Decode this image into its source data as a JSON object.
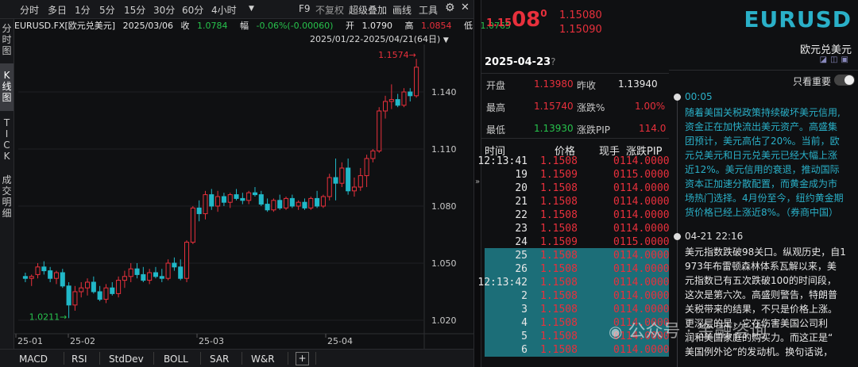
{
  "toolbar": {
    "periods": [
      "分时",
      "多日",
      "1分",
      "5分",
      "15分",
      "30分",
      "60分",
      "4小时"
    ],
    "f9": "F9",
    "nofq": "不复权",
    "overlay": "超级叠加",
    "draw": "画线",
    "tools": "工具"
  },
  "sidebar": {
    "tabs": [
      "分时图",
      "K线图",
      "TICK",
      "成交明细"
    ]
  },
  "info": {
    "symbol": "EURUSD.FX[欧元兑美元]",
    "date": "2025/03/06",
    "close_label": "收",
    "close": "1.0784",
    "change_label": "幅",
    "change": "-0.06%(-0.00060)",
    "open_label": "开",
    "open": "1.0790",
    "high_label": "高",
    "high": "1.0854",
    "low_label": "低",
    "low": "1.0765"
  },
  "range": "2025/01/22-2025/04/21(64日)",
  "annot": {
    "high": "1.1574",
    "low": "1.0211"
  },
  "axis": {
    "y_ticks": [
      "1.140",
      "1.110",
      "1.080",
      "1.050",
      "1.020"
    ],
    "x_ticks": [
      "25-01",
      "25-02",
      "25-03",
      "25-04"
    ]
  },
  "indicators": [
    "MACD",
    "RSI",
    "StdDev",
    "BOLL",
    "SAR",
    "W&R"
  ],
  "quote": {
    "price_small": "1.15",
    "price_big": "08",
    "price_sup": "0",
    "bid": "1.15080",
    "ask": "1.15090",
    "date": "2025-04-23",
    "open_l": "开盘",
    "open_v": "1.13980",
    "prev_l": "昨收",
    "prev_v": "1.13940",
    "high_l": "最高",
    "high_v": "1.15740",
    "chg_l": "涨跌%",
    "chg_v": "1.00%",
    "low_l": "最低",
    "low_v": "1.13930",
    "pip_l": "涨跌PIP",
    "pip_v": "114.0"
  },
  "ticks_header": {
    "time": "时间",
    "price": "价格",
    "vol": "现手",
    "pip": "涨跌PIP"
  },
  "ticks": [
    {
      "t": "12:13:41",
      "p": "1.1508",
      "v": "0",
      "pip": "114.0000"
    },
    {
      "t": "19",
      "p": "1.1509",
      "v": "0",
      "pip": "115.0000"
    },
    {
      "t": "20",
      "p": "1.1508",
      "v": "0",
      "pip": "114.0000"
    },
    {
      "t": "21",
      "p": "1.1508",
      "v": "0",
      "pip": "114.0000"
    },
    {
      "t": "22",
      "p": "1.1508",
      "v": "0",
      "pip": "114.0000"
    },
    {
      "t": "23",
      "p": "1.1508",
      "v": "0",
      "pip": "114.0000"
    },
    {
      "t": "24",
      "p": "1.1509",
      "v": "0",
      "pip": "115.0000"
    },
    {
      "t": "25",
      "p": "1.1508",
      "v": "0",
      "pip": "114.0000"
    },
    {
      "t": "26",
      "p": "1.1508",
      "v": "0",
      "pip": "114.0000"
    },
    {
      "t": "12:13:42",
      "p": "1.1508",
      "v": "0",
      "pip": "114.0000"
    },
    {
      "t": "2",
      "p": "1.1508",
      "v": "0",
      "pip": "114.0000"
    },
    {
      "t": "3",
      "p": "1.1508",
      "v": "0",
      "pip": "114.0000"
    },
    {
      "t": "4",
      "p": "1.1508",
      "v": "0",
      "pip": "114.0000"
    },
    {
      "t": "5",
      "p": "1.1508",
      "v": "0",
      "pip": "114.0000"
    },
    {
      "t": "6",
      "p": "1.1508",
      "v": "0",
      "pip": "114.0000"
    }
  ],
  "symbol_panel": {
    "code": "EURUSD",
    "name": "欧元兑美元",
    "toggle_label": "只看重要"
  },
  "news": [
    {
      "time": "00:05",
      "lines": [
        "随着美国关税政策持续破坏美元信用,",
        "资金正在加快流出美元资产。高盛集",
        "团预计，美元高估了20%。当前，欧",
        "元兑美元和日元兑美元已经大幅上涨",
        "近12%。美元信用的衰退，推动国际",
        "资本正加速分散配置，而黄金成为市",
        "场热门选择。4月份至今，纽约黄金期",
        "货价格已经上涨近8%。（券商中国）"
      ]
    },
    {
      "time": "04-21  22:16",
      "lines": [
        "美元指数跌破98关口。纵观历史，自1",
        "973年布雷顿森林体系瓦解以来，美",
        "元指数已有五次跌破100的时间段，",
        "这次是第六次。高盛则警告，特朗普",
        "关税带来的结果，不只是价格上涨。",
        "更深层的是，它在伤害美国公司利",
        "润和美国家庭的购买力。而这正是“",
        "美国例外论”的发动机。换句话说，"
      ]
    }
  ],
  "watermark": "公众号 · 金融咨询",
  "chart_data": {
    "type": "candlestick",
    "title": "EURUSD.FX[欧元兑美元]",
    "ylim": [
      1.015,
      1.165
    ],
    "candles": [
      [
        1.043,
        1.045,
        1.04,
        1.042
      ],
      [
        1.042,
        1.044,
        1.038,
        1.043
      ],
      [
        1.044,
        1.05,
        1.042,
        1.048
      ],
      [
        1.048,
        1.051,
        1.044,
        1.046
      ],
      [
        1.046,
        1.048,
        1.04,
        1.042
      ],
      [
        1.042,
        1.046,
        1.039,
        1.045
      ],
      [
        1.045,
        1.047,
        1.037,
        1.038
      ],
      [
        1.038,
        1.04,
        1.0211,
        1.028
      ],
      [
        1.028,
        1.038,
        1.025,
        1.035
      ],
      [
        1.035,
        1.04,
        1.032,
        1.037
      ],
      [
        1.037,
        1.042,
        1.033,
        1.04
      ],
      [
        1.04,
        1.043,
        1.034,
        1.035
      ],
      [
        1.035,
        1.038,
        1.03,
        1.031
      ],
      [
        1.031,
        1.039,
        1.029,
        1.037
      ],
      [
        1.037,
        1.04,
        1.033,
        1.034
      ],
      [
        1.034,
        1.043,
        1.032,
        1.041
      ],
      [
        1.041,
        1.046,
        1.037,
        1.043
      ],
      [
        1.043,
        1.05,
        1.04,
        1.047
      ],
      [
        1.047,
        1.05,
        1.042,
        1.044
      ],
      [
        1.044,
        1.048,
        1.04,
        1.041
      ],
      [
        1.041,
        1.047,
        1.039,
        1.045
      ],
      [
        1.045,
        1.048,
        1.042,
        1.043
      ],
      [
        1.043,
        1.047,
        1.04,
        1.042
      ],
      [
        1.042,
        1.052,
        1.041,
        1.05
      ],
      [
        1.05,
        1.053,
        1.046,
        1.048
      ],
      [
        1.048,
        1.052,
        1.041,
        1.042
      ],
      [
        1.042,
        1.062,
        1.04,
        1.061
      ],
      [
        1.061,
        1.08,
        1.06,
        1.079
      ],
      [
        1.079,
        1.083,
        1.072,
        1.076
      ],
      [
        1.076,
        1.088,
        1.073,
        1.086
      ],
      [
        1.086,
        1.089,
        1.078,
        1.08
      ],
      [
        1.08,
        1.088,
        1.077,
        1.085
      ],
      [
        1.085,
        1.087,
        1.08,
        1.082
      ],
      [
        1.082,
        1.087,
        1.079,
        1.086
      ],
      [
        1.086,
        1.089,
        1.083,
        1.084
      ],
      [
        1.084,
        1.087,
        1.081,
        1.083
      ],
      [
        1.083,
        1.088,
        1.081,
        1.087
      ],
      [
        1.087,
        1.09,
        1.085,
        1.086
      ],
      [
        1.086,
        1.088,
        1.08,
        1.081
      ],
      [
        1.081,
        1.084,
        1.077,
        1.078
      ],
      [
        1.078,
        1.084,
        1.077,
        1.083
      ],
      [
        1.083,
        1.086,
        1.078,
        1.079
      ],
      [
        1.079,
        1.085,
        1.078,
        1.084
      ],
      [
        1.084,
        1.086,
        1.079,
        1.08
      ],
      [
        1.08,
        1.083,
        1.078,
        1.082
      ],
      [
        1.082,
        1.084,
        1.078,
        1.079
      ],
      [
        1.079,
        1.085,
        1.078,
        1.084
      ],
      [
        1.084,
        1.088,
        1.079,
        1.08
      ],
      [
        1.08,
        1.086,
        1.079,
        1.085
      ],
      [
        1.085,
        1.097,
        1.083,
        1.095
      ],
      [
        1.095,
        1.105,
        1.083,
        1.092
      ],
      [
        1.092,
        1.103,
        1.09,
        1.1
      ],
      [
        1.1,
        1.105,
        1.086,
        1.088
      ],
      [
        1.088,
        1.095,
        1.085,
        1.09
      ],
      [
        1.09,
        1.1,
        1.088,
        1.096
      ],
      [
        1.096,
        1.107,
        1.09,
        1.105
      ],
      [
        1.105,
        1.11,
        1.103,
        1.109
      ],
      [
        1.109,
        1.132,
        1.108,
        1.13
      ],
      [
        1.13,
        1.138,
        1.126,
        1.135
      ],
      [
        1.135,
        1.144,
        1.131,
        1.136
      ],
      [
        1.136,
        1.139,
        1.132,
        1.133
      ],
      [
        1.133,
        1.142,
        1.132,
        1.14
      ],
      [
        1.14,
        1.142,
        1.135,
        1.138
      ],
      [
        1.138,
        1.1574,
        1.137,
        1.153
      ]
    ]
  }
}
